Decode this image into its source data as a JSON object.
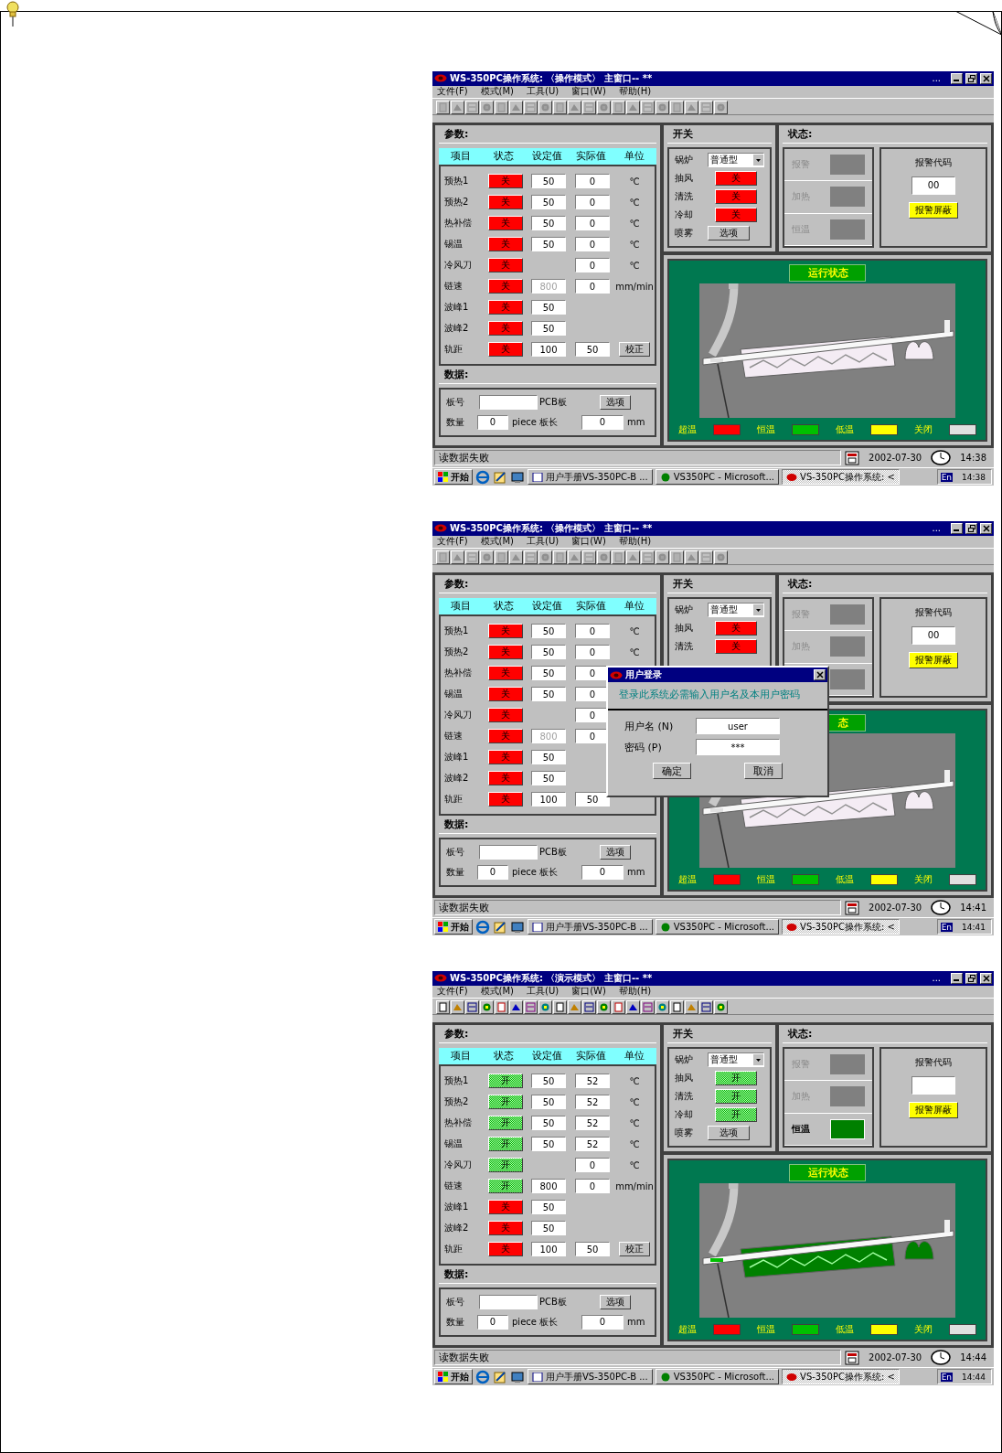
{
  "screens": [
    {
      "window": {
        "title": "WS-350PC操作系统: 〈操作模式〉 主窗口-- **",
        "overflow_mark": "...",
        "toolbar_enabled": false
      },
      "menu": [
        "文件(F)",
        "模式(M)",
        "工具(U)",
        "窗口(W)",
        "帮助(H)"
      ],
      "params": {
        "heading": "参数:",
        "columns": [
          "项目",
          "状态",
          "设定值",
          "实际值",
          "单位"
        ],
        "rows": [
          {
            "name": "预热1",
            "state": "关",
            "on": false,
            "set": "50",
            "set_disabled": false,
            "actual": "0",
            "unit": "℃"
          },
          {
            "name": "预热2",
            "state": "关",
            "on": false,
            "set": "50",
            "set_disabled": false,
            "actual": "0",
            "unit": "℃"
          },
          {
            "name": "热补偿",
            "state": "关",
            "on": false,
            "set": "50",
            "set_disabled": false,
            "actual": "0",
            "unit": "℃"
          },
          {
            "name": "锡温",
            "state": "关",
            "on": false,
            "set": "50",
            "set_disabled": false,
            "actual": "0",
            "unit": "℃"
          },
          {
            "name": "冷风刀",
            "state": "关",
            "on": false,
            "actual": "0",
            "unit": "℃"
          },
          {
            "name": "链速",
            "state": "关",
            "on": false,
            "set": "800",
            "set_disabled": true,
            "actual": "0",
            "unit": "mm/min"
          },
          {
            "name": "波峰1",
            "state": "关",
            "on": false,
            "set": "50",
            "set_disabled": false
          },
          {
            "name": "波峰2",
            "state": "关",
            "on": false,
            "set": "50",
            "set_disabled": false
          },
          {
            "name": "轨距",
            "state": "关",
            "on": false,
            "set": "100",
            "set_disabled": false,
            "actual": "50",
            "button": "校正"
          }
        ]
      },
      "data": {
        "heading": "数据:",
        "board_no_label": "板号",
        "pcb_label": "PCB板",
        "options_button": "选项",
        "qty_label": "数量",
        "qty": "0",
        "qty_unit": "piece",
        "length_label": "板长",
        "length": "0",
        "length_unit": "mm"
      },
      "switches": {
        "heading": "开关",
        "boiler_label": "锅炉",
        "boiler_value": "普通型",
        "rows": [
          {
            "name": "抽风",
            "state": "关",
            "on": false
          },
          {
            "name": "清洗",
            "state": "关",
            "on": false
          },
          {
            "name": "冷却",
            "state": "关",
            "on": false
          }
        ],
        "spray_label": "喷雾",
        "spray_button": "选项"
      },
      "status": {
        "heading": "状态:",
        "indicators": [
          {
            "label": "报警",
            "active": false
          },
          {
            "label": "加热",
            "active": false
          },
          {
            "label": "恒温",
            "active": false
          }
        ],
        "alarm_code_label": "报警代码",
        "alarm_code": "00",
        "mask_button": "报警屏蔽"
      },
      "run": {
        "title": "运行状态",
        "running": false,
        "legend": [
          {
            "label": "超温",
            "color": "#ff0000"
          },
          {
            "label": "恒温",
            "color": "#00c000"
          },
          {
            "label": "低温",
            "color": "#ffff00"
          },
          {
            "label": "关闭",
            "color": "#e0e0e0"
          }
        ]
      },
      "status_bar": {
        "message": "读数据失败",
        "date": "2002-07-30",
        "time": "14:38"
      },
      "taskbar": {
        "start": "开始",
        "tasks": [
          {
            "label": "用户手册VS-350PC-B ...",
            "selected": false
          },
          {
            "label": "VS350PC - Microsoft...",
            "selected": false
          },
          {
            "label": "VS-350PC操作系统: <",
            "selected": true
          }
        ],
        "lang": "En",
        "time": "14:38"
      }
    },
    {
      "window": {
        "title": "WS-350PC操作系统: 〈操作模式〉 主窗口-- **",
        "overflow_mark": "...",
        "toolbar_enabled": false
      },
      "menu": [
        "文件(F)",
        "模式(M)",
        "工具(U)",
        "窗口(W)",
        "帮助(H)"
      ],
      "params": {
        "heading": "参数:",
        "columns": [
          "项目",
          "状态",
          "设定值",
          "实际值",
          "单位"
        ],
        "rows": [
          {
            "name": "预热1",
            "state": "关",
            "on": false,
            "set": "50",
            "set_disabled": false,
            "actual": "0",
            "unit": "℃"
          },
          {
            "name": "预热2",
            "state": "关",
            "on": false,
            "set": "50",
            "set_disabled": false,
            "actual": "0",
            "unit": "℃"
          },
          {
            "name": "热补偿",
            "state": "关",
            "on": false,
            "set": "50",
            "set_disabled": false,
            "actual": "0"
          },
          {
            "name": "锡温",
            "state": "关",
            "on": false,
            "set": "50",
            "set_disabled": false,
            "actual": "0"
          },
          {
            "name": "冷风刀",
            "state": "关",
            "on": false,
            "actual": "0"
          },
          {
            "name": "链速",
            "state": "关",
            "on": false,
            "set": "800",
            "set_disabled": true,
            "actual": "0"
          },
          {
            "name": "波峰1",
            "state": "关",
            "on": false,
            "set": "50",
            "set_disabled": false
          },
          {
            "name": "波峰2",
            "state": "关",
            "on": false,
            "set": "50",
            "set_disabled": false
          },
          {
            "name": "轨距",
            "state": "关",
            "on": false,
            "set": "100",
            "set_disabled": false,
            "actual": "50"
          }
        ]
      },
      "data": {
        "heading": "数据:",
        "board_no_label": "板号",
        "pcb_label": "PCB板",
        "options_button": "选项",
        "qty_label": "数量",
        "qty": "0",
        "qty_unit": "piece",
        "length_label": "板长",
        "length": "0",
        "length_unit": "mm"
      },
      "switches": {
        "heading": "开关",
        "boiler_label": "锅炉",
        "boiler_value": "普通型",
        "rows": [
          {
            "name": "抽风",
            "state": "关",
            "on": false
          },
          {
            "name": "清洗",
            "state": "关",
            "on": false
          }
        ]
      },
      "status": {
        "heading": "状态:",
        "indicators": [
          {
            "label": "报警",
            "active": false
          },
          {
            "label": "加热",
            "active": false
          },
          {
            "active": false
          }
        ],
        "alarm_code_label": "报警代码",
        "alarm_code": "00",
        "mask_button": "报警屏蔽"
      },
      "run": {
        "title": "态",
        "running": false,
        "legend": [
          {
            "label": "超温",
            "color": "#ff0000"
          },
          {
            "label": "恒温",
            "color": "#00c000"
          },
          {
            "label": "低温",
            "color": "#ffff00"
          },
          {
            "label": "关闭",
            "color": "#e0e0e0"
          }
        ]
      },
      "status_bar": {
        "message": "读数据失败",
        "date": "2002-07-30",
        "time": "14:41"
      },
      "taskbar": {
        "start": "开始",
        "tasks": [
          {
            "label": "用户手册VS-350PC-B ...",
            "selected": false
          },
          {
            "label": "VS350PC - Microsoft...",
            "selected": false
          },
          {
            "label": "VS-350PC操作系统: <",
            "selected": true
          }
        ],
        "lang": "En",
        "time": "14:41"
      },
      "dialog": {
        "title": "用户登录",
        "message": "登录此系统必需输入用户名及本用户密码",
        "fields": [
          {
            "label": "用户名 (N)",
            "value": "user"
          },
          {
            "label": "密码 (P)",
            "value": "***"
          }
        ],
        "buttons": [
          "确定",
          "取消"
        ]
      }
    },
    {
      "window": {
        "title": "WS-350PC操作系统: 〈演示模式〉 主窗口-- **",
        "overflow_mark": "...",
        "toolbar_enabled": true
      },
      "menu": [
        "文件(F)",
        "模式(M)",
        "工具(U)",
        "窗口(W)",
        "帮助(H)"
      ],
      "params": {
        "heading": "参数:",
        "columns": [
          "项目",
          "状态",
          "设定值",
          "实际值",
          "单位"
        ],
        "rows": [
          {
            "name": "预热1",
            "state": "开",
            "on": true,
            "set": "50",
            "set_disabled": false,
            "actual": "52",
            "unit": "℃"
          },
          {
            "name": "预热2",
            "state": "开",
            "on": true,
            "set": "50",
            "set_disabled": false,
            "actual": "52",
            "unit": "℃"
          },
          {
            "name": "热补偿",
            "state": "开",
            "on": true,
            "set": "50",
            "set_disabled": false,
            "actual": "52",
            "unit": "℃"
          },
          {
            "name": "锡温",
            "state": "开",
            "on": true,
            "set": "50",
            "set_disabled": false,
            "actual": "52",
            "unit": "℃"
          },
          {
            "name": "冷风刀",
            "state": "开",
            "on": true,
            "actual": "0",
            "unit": "℃"
          },
          {
            "name": "链速",
            "state": "开",
            "on": true,
            "set": "800",
            "set_disabled": false,
            "actual": "0",
            "unit": "mm/min"
          },
          {
            "name": "波峰1",
            "state": "关",
            "on": false,
            "set": "50",
            "set_disabled": false
          },
          {
            "name": "波峰2",
            "state": "关",
            "on": false,
            "set": "50",
            "set_disabled": false
          },
          {
            "name": "轨距",
            "state": "关",
            "on": false,
            "set": "100",
            "set_disabled": false,
            "actual": "50",
            "button": "校正"
          }
        ]
      },
      "data": {
        "heading": "数据:",
        "board_no_label": "板号",
        "pcb_label": "PCB板",
        "options_button": "选项",
        "qty_label": "数量",
        "qty": "0",
        "qty_unit": "piece",
        "length_label": "板长",
        "length": "0",
        "length_unit": "mm"
      },
      "switches": {
        "heading": "开关",
        "boiler_label": "锅炉",
        "boiler_value": "普通型",
        "rows": [
          {
            "name": "抽风",
            "state": "开",
            "on": true
          },
          {
            "name": "清洗",
            "state": "开",
            "on": true
          },
          {
            "name": "冷却",
            "state": "开",
            "on": true
          }
        ],
        "spray_label": "喷雾",
        "spray_button": "选项"
      },
      "status": {
        "heading": "状态:",
        "indicators": [
          {
            "label": "报警",
            "active": false
          },
          {
            "label": "加热",
            "active": false
          },
          {
            "label": "恒温",
            "active": true
          }
        ],
        "alarm_code_label": "报警代码",
        "mask_button": "报警屏蔽"
      },
      "run": {
        "title": "运行状态",
        "running": true,
        "legend": [
          {
            "label": "超温",
            "color": "#ff0000"
          },
          {
            "label": "恒温",
            "color": "#00c000"
          },
          {
            "label": "低温",
            "color": "#ffff00"
          },
          {
            "label": "关闭",
            "color": "#e0e0e0"
          }
        ]
      },
      "status_bar": {
        "message": "读数据失败",
        "date": "2002-07-30",
        "time": "14:44"
      },
      "taskbar": {
        "start": "开始",
        "tasks": [
          {
            "label": "用户手册VS-350PC-B ...",
            "selected": false
          },
          {
            "label": "VS350PC - Microsoft...",
            "selected": false
          },
          {
            "label": "VS-350PC操作系统: <",
            "selected": true
          }
        ],
        "lang": "En",
        "time": "14:44"
      }
    }
  ]
}
